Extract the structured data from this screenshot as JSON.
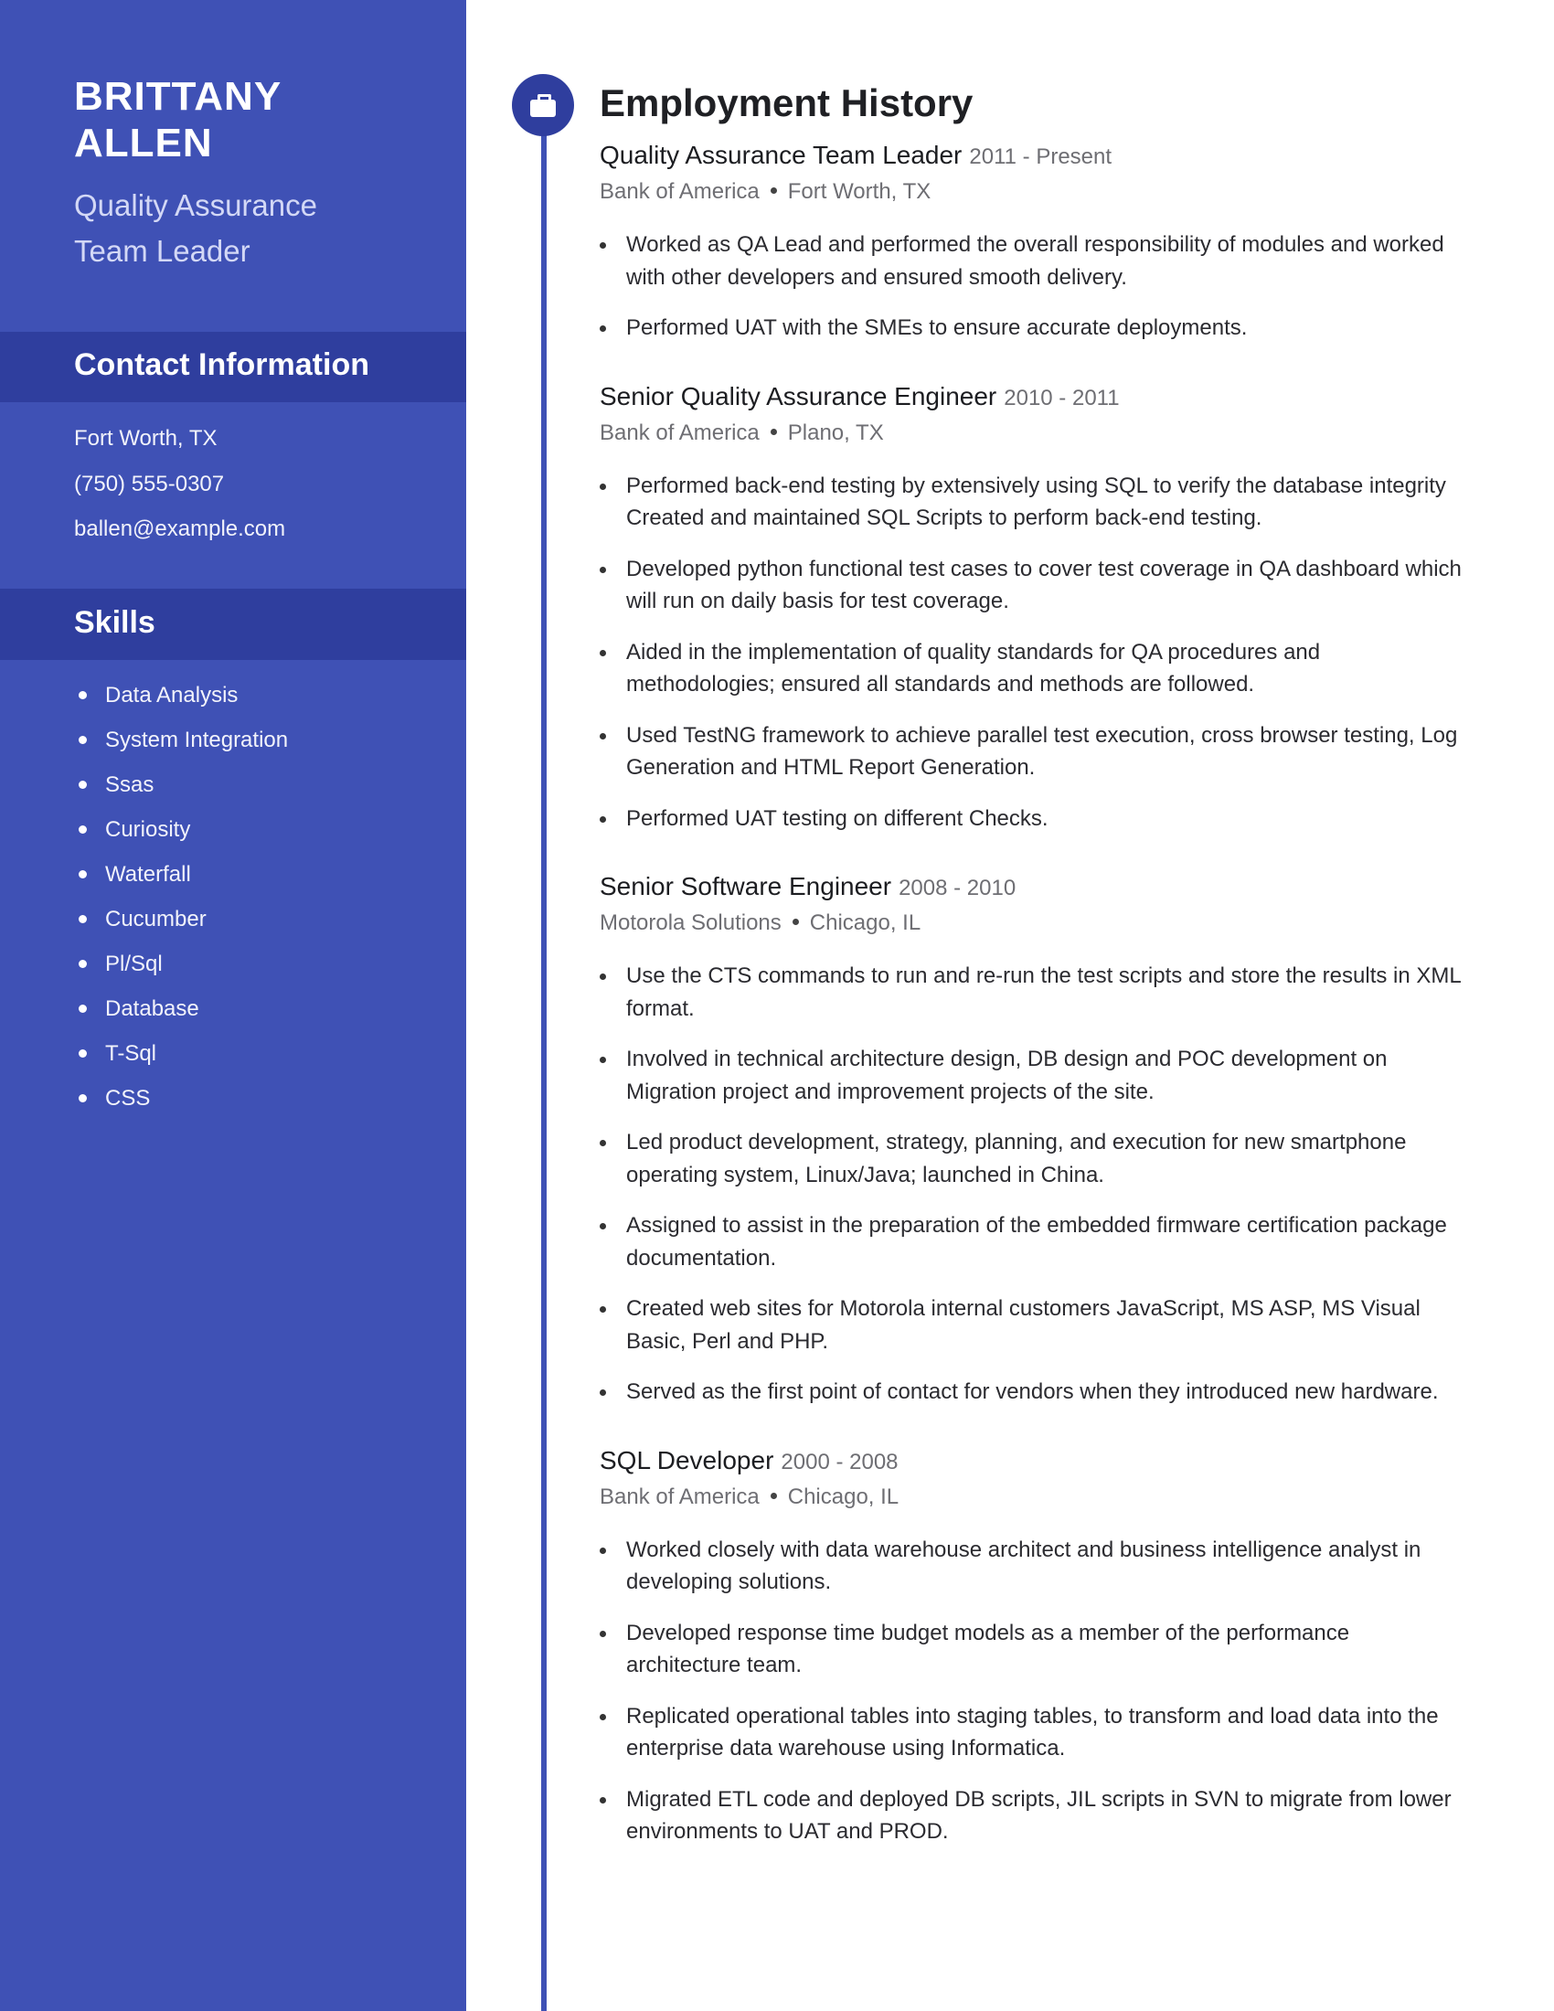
{
  "profile": {
    "name_line1": "BRITTANY",
    "name_line2": "ALLEN",
    "title_line1": "Quality Assurance",
    "title_line2": "Team Leader"
  },
  "contact": {
    "heading": "Contact Information",
    "location": "Fort Worth, TX",
    "phone": "(750) 555-0307",
    "email": "ballen@example.com"
  },
  "skills": {
    "heading": "Skills",
    "items": [
      "Data Analysis",
      "System Integration",
      "Ssas",
      "Curiosity",
      "Waterfall",
      "Cucumber",
      "Pl/Sql",
      "Database",
      "T-Sql",
      "CSS"
    ]
  },
  "employment": {
    "heading": "Employment History",
    "icon": "briefcase-icon",
    "accent_color": "#3f51b5",
    "jobs": [
      {
        "title": "Quality Assurance Team Leader",
        "dates": "2011 - Present",
        "company": "Bank of America",
        "location": "Fort Worth, TX",
        "bullets": [
          "Worked as QA Lead and performed the overall responsibility of modules and worked with other developers and ensured smooth delivery.",
          "Performed UAT with the SMEs to ensure accurate deployments."
        ]
      },
      {
        "title": "Senior Quality Assurance Engineer",
        "dates": "2010 - 2011",
        "company": "Bank of America",
        "location": "Plano, TX",
        "bullets": [
          "Performed back-end testing by extensively using SQL to verify the database integrity Created and maintained SQL Scripts to perform back-end testing.",
          "Developed python functional test cases to cover test coverage in QA dashboard which will run on daily basis for test coverage.",
          "Aided in the implementation of quality standards for QA procedures and methodologies; ensured all standards and methods are followed.",
          "Used TestNG framework to achieve parallel test execution, cross browser testing, Log Generation and HTML Report Generation.",
          "Performed UAT testing on different Checks."
        ]
      },
      {
        "title": "Senior Software Engineer",
        "dates": "2008 - 2010",
        "company": "Motorola Solutions",
        "location": "Chicago, IL",
        "bullets": [
          "Use the CTS commands to run and re-run the test scripts and store the results in XML format.",
          "Involved in technical architecture design, DB design and POC development on Migration project and improvement projects of the site.",
          "Led product development, strategy, planning, and execution for new smartphone operating system, Linux/Java; launched in China.",
          "Assigned to assist in the preparation of the embedded firmware certification package documentation.",
          "Created web sites for Motorola internal customers JavaScript, MS ASP, MS Visual Basic, Perl and PHP.",
          "Served as the first point of contact for vendors when they introduced new hardware."
        ]
      },
      {
        "title": "SQL Developer",
        "dates": "2000 - 2008",
        "company": "Bank of America",
        "location": "Chicago, IL",
        "bullets": [
          "Worked closely with data warehouse architect and business intelligence analyst in developing solutions.",
          "Developed response time budget models as a member of the performance architecture team.",
          "Replicated operational tables into staging tables, to transform and load data into the enterprise data warehouse using Informatica.",
          "Migrated ETL code and deployed DB scripts, JIL scripts in SVN to migrate from lower environments to UAT and PROD."
        ]
      }
    ]
  }
}
